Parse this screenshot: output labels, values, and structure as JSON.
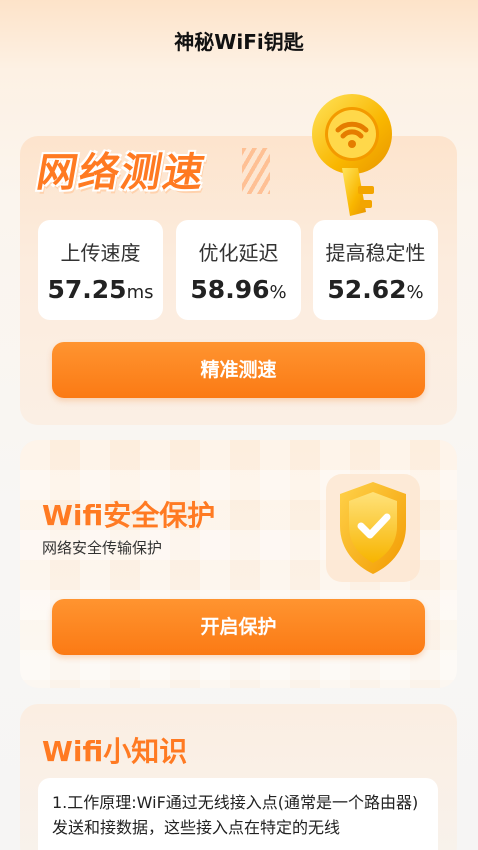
{
  "app": {
    "title": "神秘WiFi钥匙"
  },
  "speed": {
    "heading": "网络测速",
    "stats": [
      {
        "label": "上传速度",
        "value": "57.25",
        "unit": "ms"
      },
      {
        "label": "优化延迟",
        "value": "58.96",
        "unit": "%"
      },
      {
        "label": "提高稳定性",
        "value": "52.62",
        "unit": "%"
      }
    ],
    "button_label": "精准测速",
    "icon": "wifi-key-icon"
  },
  "security": {
    "title": "Wifi安全保护",
    "subtitle": "网络安全传输保护",
    "button_label": "开启保护",
    "icon": "shield-check-icon"
  },
  "knowledge": {
    "title": "Wifi小知识",
    "text": "1.工作原理:WiF通过无线接入点(通常是一个路由器)发送和接数据，这些接入点在特定的无线"
  },
  "colors": {
    "accent": "#fb7a14",
    "heading": "#ff7a22",
    "gold": "#f7b500"
  }
}
